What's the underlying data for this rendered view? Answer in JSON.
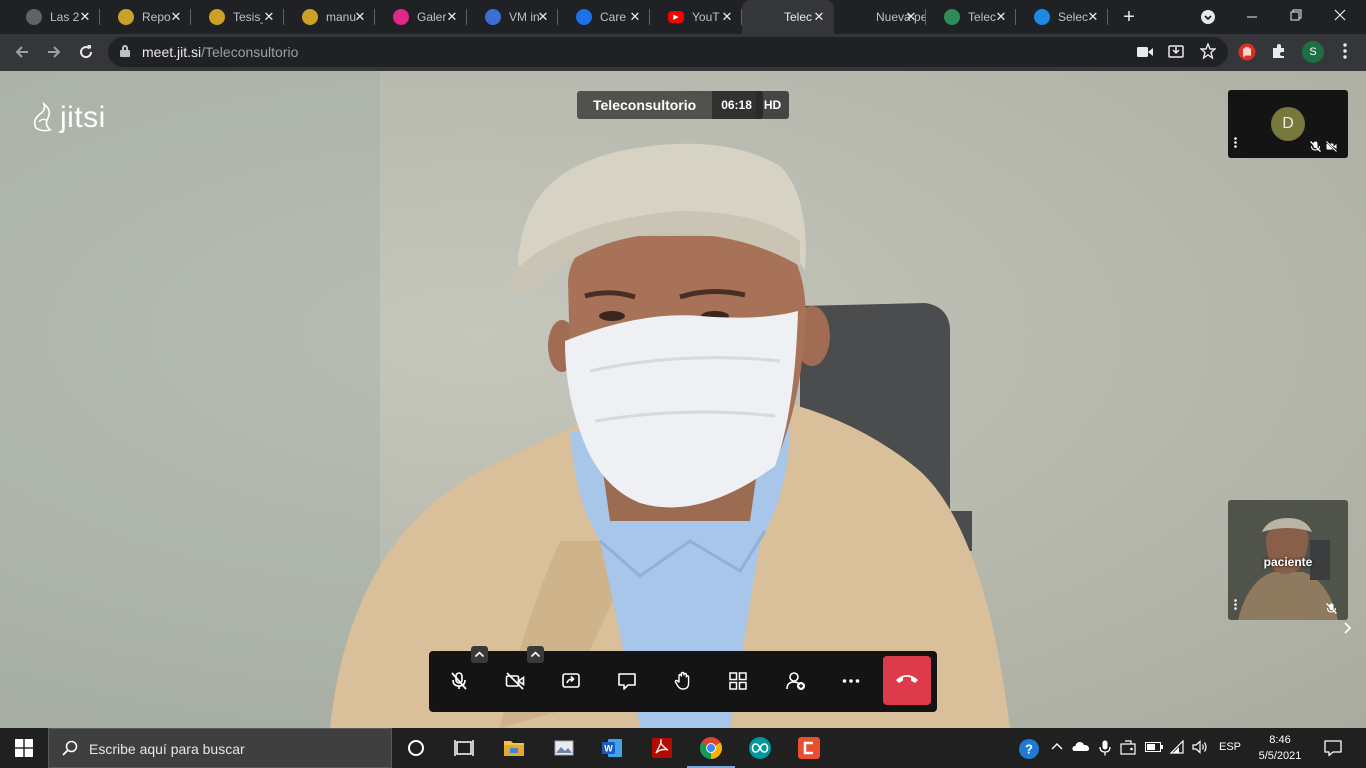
{
  "browser": {
    "tabs": [
      {
        "title": "Las 2",
        "icon": "globe-icon"
      },
      {
        "title": "Repo",
        "icon": "seal-icon"
      },
      {
        "title": "Tesis_",
        "icon": "seal-icon"
      },
      {
        "title": "manu",
        "icon": "seal-icon"
      },
      {
        "title": "Galer",
        "icon": "gallery-icon"
      },
      {
        "title": "VM in",
        "icon": "chip-icon"
      },
      {
        "title": "Care",
        "icon": "flag-icon"
      },
      {
        "title": "YouT",
        "icon": "youtube-icon"
      },
      {
        "title": "Telec",
        "icon": "jitsi-icon",
        "active": true
      },
      {
        "title": "Nueva pe",
        "icon": "none"
      },
      {
        "title": "Telec",
        "icon": "doctor-icon"
      },
      {
        "title": "Selec",
        "icon": "list-icon"
      }
    ],
    "new_tab": "+",
    "url_host": "meet.jit.si",
    "url_path": "/Teleconsultorio",
    "profile_initial": "S"
  },
  "meeting": {
    "logo_text": "jitsi",
    "subject": "Teleconsultorio",
    "timer": "06:18",
    "quality_badge": "HD",
    "participants": [
      {
        "initial": "D",
        "audio_muted": true,
        "video_muted": true
      },
      {
        "name": "paciente",
        "audio_muted": true
      }
    ]
  },
  "taskbar": {
    "search_placeholder": "Escribe aquí para buscar",
    "lang": "ESP",
    "time": "8:46",
    "date": "5/5/2021"
  },
  "colors": {
    "hangup": "#dd3a4c",
    "avatar": "#77783b",
    "profile": "#1e6f43"
  }
}
